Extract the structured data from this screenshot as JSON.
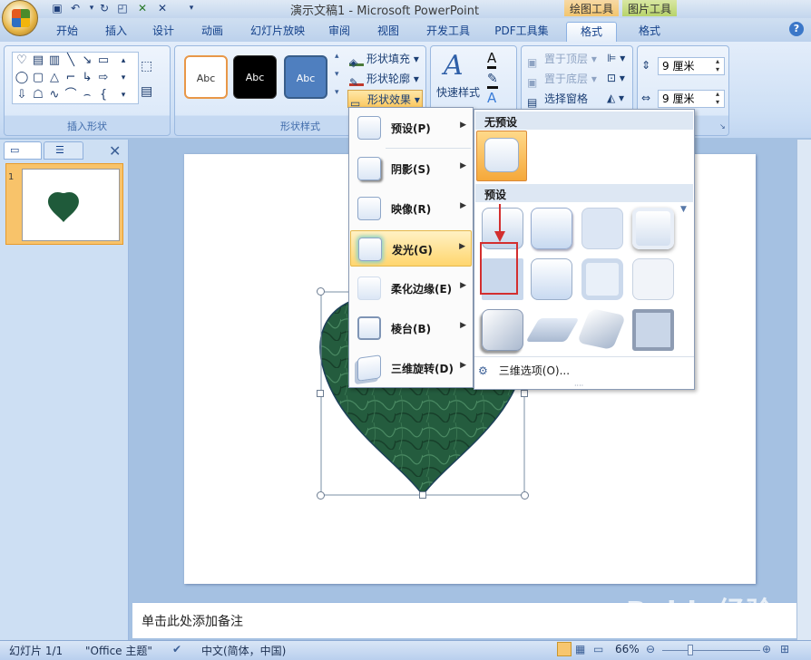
{
  "window": {
    "title": "演示文稿1 - Microsoft PowerPoint",
    "context_tabs": [
      "绘图工具",
      "图片工具"
    ]
  },
  "tabs": [
    "开始",
    "插入",
    "设计",
    "动画",
    "幻灯片放映",
    "审阅",
    "视图",
    "开发工具",
    "PDF工具集",
    "格式",
    "格式"
  ],
  "active_tab": "格式",
  "ribbon": {
    "insert_shapes": {
      "label": "插入形状"
    },
    "shape_styles": {
      "label": "形状样式",
      "swatches": [
        "Abc",
        "Abc",
        "Abc"
      ],
      "fill": "形状填充",
      "outline": "形状轮廓",
      "effects": "形状效果"
    },
    "quick_styles": "快速样式",
    "arrange": {
      "bring_front": "置于顶层",
      "send_back": "置于底层",
      "selection_pane": "选择窗格"
    },
    "size": {
      "height": "9 厘米",
      "width": "9 厘米"
    }
  },
  "effects_menu": [
    {
      "label": "预设(P)"
    },
    {
      "label": "阴影(S)"
    },
    {
      "label": "映像(R)"
    },
    {
      "label": "发光(G)"
    },
    {
      "label": "柔化边缘(E)"
    },
    {
      "label": "棱台(B)"
    },
    {
      "label": "三维旋转(D)"
    }
  ],
  "highlighted_menu_item": "发光(G)",
  "submenu": {
    "no_preset_header": "无预设",
    "preset_header": "预设",
    "three_d_options": "三维选项(O)..."
  },
  "slide_panel": {
    "slide_number": "1"
  },
  "notes": {
    "placeholder": "单击此处添加备注"
  },
  "status": {
    "slide": "幻灯片 1/1",
    "theme": "\"Office 主题\"",
    "language": "中文(简体，中国)",
    "zoom": "66%"
  },
  "watermark": "Baidu经验"
}
